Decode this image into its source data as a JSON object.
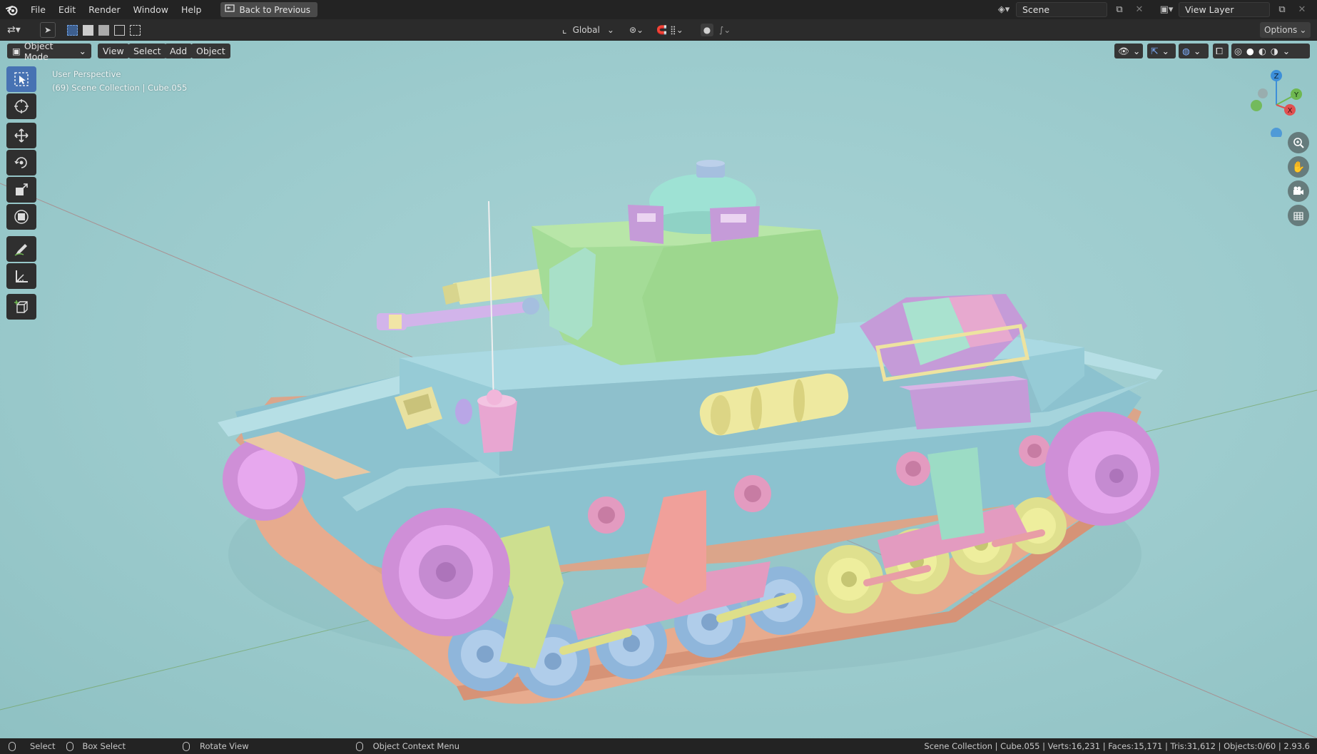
{
  "menu": {
    "logo": "blender-logo-icon",
    "items": [
      "File",
      "Edit",
      "Render",
      "Window",
      "Help"
    ],
    "back_button": "Back to Previous"
  },
  "topright": {
    "scene_value": "Scene",
    "view_layer_value": "View Layer"
  },
  "toolheader": {
    "orientation": "Global",
    "options": "Options"
  },
  "viewport_header": {
    "mode": "Object Mode",
    "view": "View",
    "select": "Select",
    "add": "Add",
    "object": "Object"
  },
  "overlay": {
    "perspective": "User Perspective",
    "collection": "(69) Scene Collection | Cube.055"
  },
  "gizmo": {
    "x": "X",
    "y": "Y",
    "z": "Z"
  },
  "tools": [
    "select-box-icon",
    "cursor-icon",
    "move-icon",
    "rotate-icon",
    "scale-icon",
    "transform-icon",
    "annotate-icon",
    "measure-icon",
    "add-cube-icon"
  ],
  "nav": [
    "zoom-icon",
    "pan-hand-icon",
    "camera-icon",
    "grid-ortho-icon"
  ],
  "statusbar": {
    "select": "Select",
    "box_select": "Box Select",
    "rotate_view": "Rotate View",
    "context_menu": "Object Context Menu",
    "stats": "Scene Collection | Cube.055 | Verts:16,231 | Faces:15,171 | Tris:31,612 | Objects:0/60 | 2.93.6"
  },
  "colors": {
    "viewport_bg": "#9ccbcd",
    "active_tool": "#4772b3",
    "axis_red": "#e05050",
    "axis_green": "#6fb850",
    "axis_blue": "#3d8fd9"
  }
}
